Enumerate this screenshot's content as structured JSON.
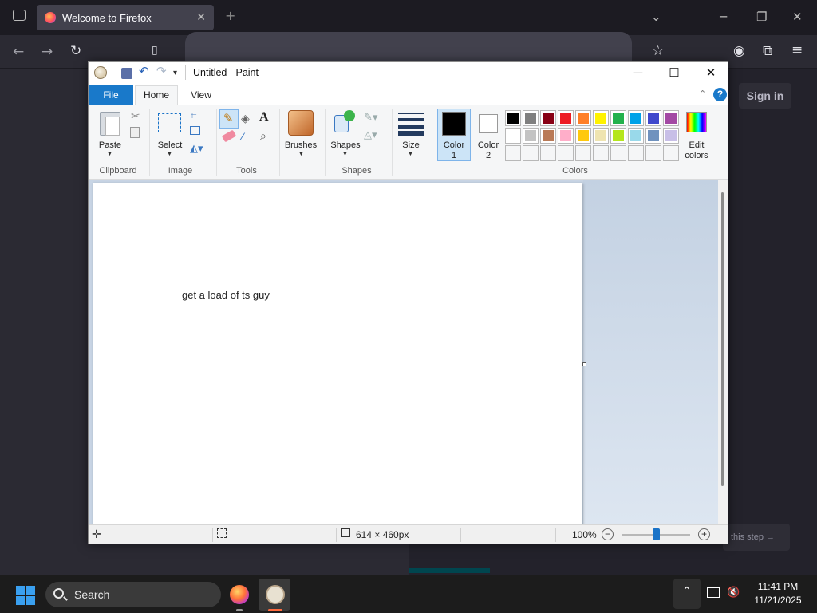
{
  "firefox": {
    "tab_title": "Welcome to Firefox",
    "tab_close": "✕",
    "new_tab": "+",
    "sign_in": "Sign in",
    "skip_step": "this step →",
    "onboarding_progress": 0.2
  },
  "paint": {
    "title": "Untitled - Paint",
    "window_controls": {
      "minimize": "─",
      "maximize": "☐",
      "close": "✕"
    },
    "quick_access": {
      "save_icon": "save-icon",
      "undo_icon": "undo-icon",
      "redo_icon": "redo-icon",
      "customize": "▾"
    },
    "tabs": {
      "file": "File",
      "home": "Home",
      "view": "View"
    },
    "help": "?",
    "ribbon_collapse": "⌃",
    "ribbon": {
      "clipboard": {
        "group": "Clipboard",
        "paste": "Paste"
      },
      "image": {
        "group": "Image",
        "select": "Select"
      },
      "tools": {
        "group": "Tools"
      },
      "brushes": "Brushes",
      "shapes": {
        "group": "Shapes",
        "shapes": "Shapes"
      },
      "size": "Size",
      "colors": {
        "group": "Colors",
        "color1": "Color\n1",
        "color1_l1": "Color",
        "color1_l2": "1",
        "color2_l1": "Color",
        "color2_l2": "2",
        "edit_l1": "Edit",
        "edit_l2": "colors",
        "palette_row1": [
          "#000000",
          "#7f7f7f",
          "#880015",
          "#ed1c24",
          "#ff7f27",
          "#fff200",
          "#22b14c",
          "#00a2e8",
          "#3f48cc",
          "#a349a4"
        ],
        "palette_row2": [
          "#ffffff",
          "#c3c3c3",
          "#b97a57",
          "#ffaec9",
          "#ffc90e",
          "#efe4b0",
          "#b5e61d",
          "#99d9ea",
          "#7092be",
          "#c8bfe7"
        ],
        "primary": "#000000",
        "secondary": "#ffffff"
      }
    },
    "canvas_text": "get a load of ts guy",
    "status": {
      "canvas_size": "614 × 460px",
      "zoom": "100%",
      "zoom_minus": "−",
      "zoom_plus": "+",
      "zoom_level": 0.5
    }
  },
  "taskbar": {
    "search": "Search",
    "time": "11:41 PM",
    "date": "11/21/2025",
    "tray_up": "⌃",
    "vol": "🔇"
  }
}
